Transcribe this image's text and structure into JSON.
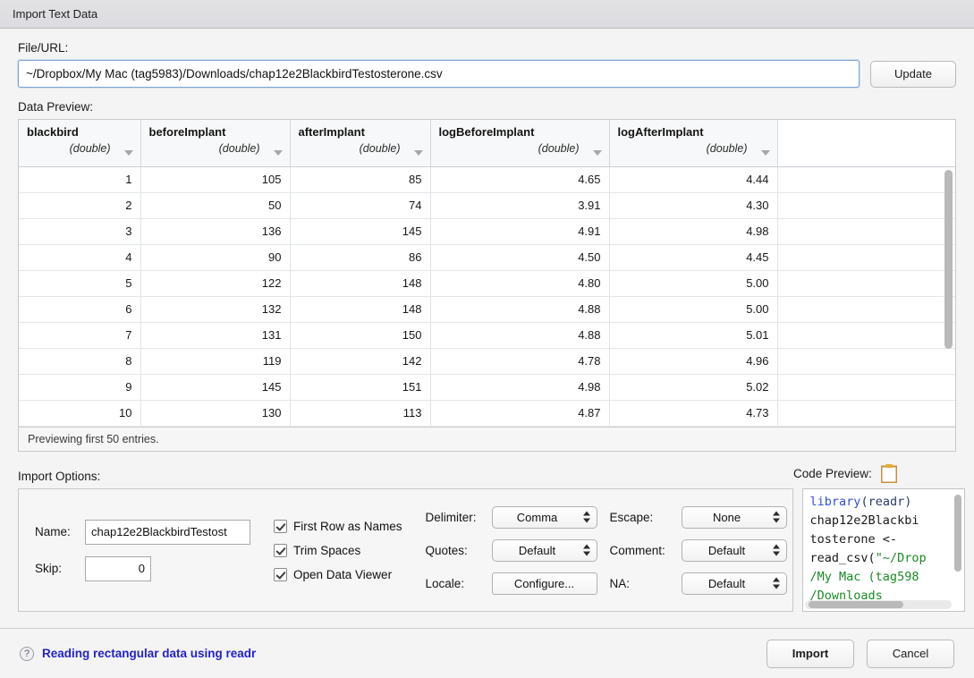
{
  "window": {
    "title": "Import Text Data"
  },
  "file": {
    "label": "File/URL:",
    "value": "~/Dropbox/My Mac (tag5983)/Downloads/chap12e2BlackbirdTestosterone.csv",
    "placeholder": "File/URL",
    "update_label": "Update"
  },
  "preview": {
    "label": "Data Preview:",
    "status": "Previewing first 50 entries.",
    "columns": [
      {
        "name": "blackbird",
        "type": "(double)"
      },
      {
        "name": "beforeImplant",
        "type": "(double)"
      },
      {
        "name": "afterImplant",
        "type": "(double)"
      },
      {
        "name": "logBeforeImplant",
        "type": "(double)"
      },
      {
        "name": "logAfterImplant",
        "type": "(double)"
      }
    ],
    "rows": [
      [
        "1",
        "105",
        "85",
        "4.65",
        "4.44"
      ],
      [
        "2",
        "50",
        "74",
        "3.91",
        "4.30"
      ],
      [
        "3",
        "136",
        "145",
        "4.91",
        "4.98"
      ],
      [
        "4",
        "90",
        "86",
        "4.50",
        "4.45"
      ],
      [
        "5",
        "122",
        "148",
        "4.80",
        "5.00"
      ],
      [
        "6",
        "132",
        "148",
        "4.88",
        "5.00"
      ],
      [
        "7",
        "131",
        "150",
        "4.88",
        "5.01"
      ],
      [
        "8",
        "119",
        "142",
        "4.78",
        "4.96"
      ],
      [
        "9",
        "145",
        "151",
        "4.98",
        "5.02"
      ],
      [
        "10",
        "130",
        "113",
        "4.87",
        "4.73"
      ]
    ]
  },
  "options": {
    "title": "Import Options:",
    "name_label": "Name:",
    "name_value": "chap12e2BlackbirdTestost",
    "skip_label": "Skip:",
    "skip_value": "0",
    "checkboxes": [
      {
        "label": "First Row as Names",
        "checked": true
      },
      {
        "label": "Trim Spaces",
        "checked": true
      },
      {
        "label": "Open Data Viewer",
        "checked": true
      }
    ],
    "delimiter_label": "Delimiter:",
    "delimiter_value": "Comma",
    "quotes_label": "Quotes:",
    "quotes_value": "Default",
    "locale_label": "Locale:",
    "locale_button": "Configure...",
    "escape_label": "Escape:",
    "escape_value": "None",
    "comment_label": "Comment:",
    "comment_value": "Default",
    "na_label": "NA:",
    "na_value": "Default"
  },
  "code_preview": {
    "label": "Code Preview:",
    "line1_kw": "library",
    "line1_rest": "(readr)",
    "line2": "chap12e2Blackbi",
    "line3": "tosterone <-",
    "line4_fn": "read_csv(",
    "line4_str": "\"~/Drop",
    "line5": "/My Mac (tag598",
    "line6": "/Downloads"
  },
  "footer": {
    "help_icon": "question-mark-icon",
    "help_text": "Reading rectangular data using readr",
    "import_label": "Import",
    "cancel_label": "Cancel"
  },
  "colors": {
    "accent_blue": "#2323c8",
    "focus_border": "#7aa3d9",
    "code_keyword": "#2f4fd8",
    "code_string": "#1a8a24",
    "clipboard": "#c8903c"
  }
}
